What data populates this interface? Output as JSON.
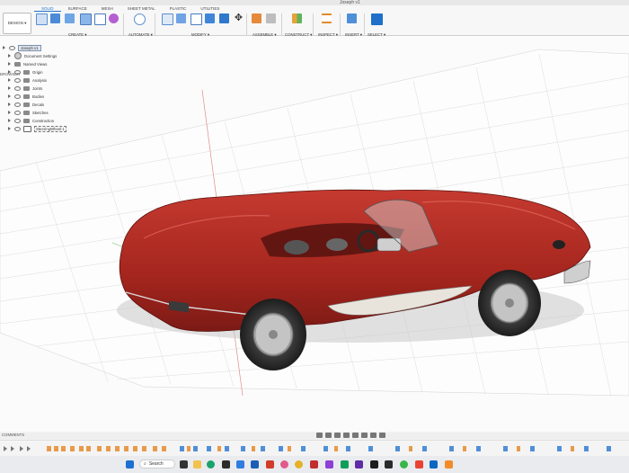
{
  "window": {
    "title": "Joseph v1"
  },
  "ribbon": {
    "tabs": [
      {
        "label": "SOLID",
        "active": true
      },
      {
        "label": "SURFACE"
      },
      {
        "label": "MESH"
      },
      {
        "label": "SHEET METAL"
      },
      {
        "label": "PLASTIC"
      },
      {
        "label": "UTILITIES"
      }
    ],
    "workspace_button": "DESIGN ▾",
    "groups": {
      "create": "CREATE ▾",
      "automate": "AUTOMATE ▾",
      "modify": "MODIFY ▾",
      "assemble": "ASSEMBLE ▾",
      "construct": "CONSTRUCT ▾",
      "inspect": "INSPECT ▾",
      "insert": "INSERT ▾",
      "select": "SELECT ▾"
    }
  },
  "browser": {
    "header": "BROWSER",
    "root": "Joseph v1",
    "items": [
      "Document Settings",
      "Named Views",
      "Origin",
      "Analysis",
      "Joints",
      "Bodies",
      "Decals",
      "Sketches",
      "Construction",
      "SteeringWheel:1"
    ]
  },
  "bottom": {
    "comments": "COMMENTS"
  },
  "taskbar": {
    "search_placeholder": "Search"
  },
  "colors": {
    "car_body": "#a8271f",
    "accent_blue": "#1e70c9",
    "grid_line": "#dcdcdc"
  }
}
